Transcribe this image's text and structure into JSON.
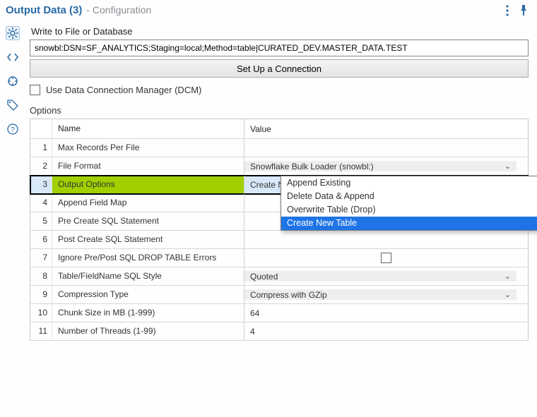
{
  "titlebar": {
    "main": "Output Data (3)",
    "sub": "- Configuration"
  },
  "section": {
    "write_to_label": "Write to File or Database",
    "connection_string": "snowbl:DSN=SF_ANALYTICS;Staging=local;Method=table|CURATED_DEV.MASTER_DATA.TEST",
    "setup_button": "Set Up a Connection",
    "dcm_label": "Use Data Connection Manager (DCM)"
  },
  "colors": {
    "accent": "#2a6aa6",
    "row_select_bg": "#d7e8f8",
    "name_highlight": "#a0d000",
    "dropdown_sel": "#1e74e6"
  },
  "options": {
    "heading": "Options",
    "columns": {
      "name": "Name",
      "value": "Value"
    },
    "rows": [
      {
        "n": "1",
        "name": "Max Records Per File",
        "value": "",
        "kind": "text"
      },
      {
        "n": "2",
        "name": "File Format",
        "value": "Snowflake Bulk Loader (snowbl:)",
        "kind": "select"
      },
      {
        "n": "3",
        "name": "Output Options",
        "value": "Create New Table",
        "kind": "select-open",
        "selected": true
      },
      {
        "n": "4",
        "name": "Append Field Map",
        "value": "",
        "kind": "text"
      },
      {
        "n": "5",
        "name": "Pre Create SQL Statement",
        "value": "",
        "kind": "text"
      },
      {
        "n": "6",
        "name": "Post Create SQL Statement",
        "value": "",
        "kind": "text"
      },
      {
        "n": "7",
        "name": "Ignore Pre/Post SQL DROP TABLE Errors",
        "value": "",
        "kind": "checkbox"
      },
      {
        "n": "8",
        "name": "Table/FieldName SQL Style",
        "value": "Quoted",
        "kind": "select"
      },
      {
        "n": "9",
        "name": "Compression Type",
        "value": "Compress with GZip",
        "kind": "select"
      },
      {
        "n": "10",
        "name": "Chunk Size in MB (1-999)",
        "value": "64",
        "kind": "text"
      },
      {
        "n": "11",
        "name": "Number of Threads (1-99)",
        "value": "4",
        "kind": "text"
      }
    ],
    "dropdown": {
      "items": [
        "Append Existing",
        "Delete Data & Append",
        "Overwrite Table (Drop)",
        "Create New Table"
      ],
      "selected_index": 3
    }
  }
}
